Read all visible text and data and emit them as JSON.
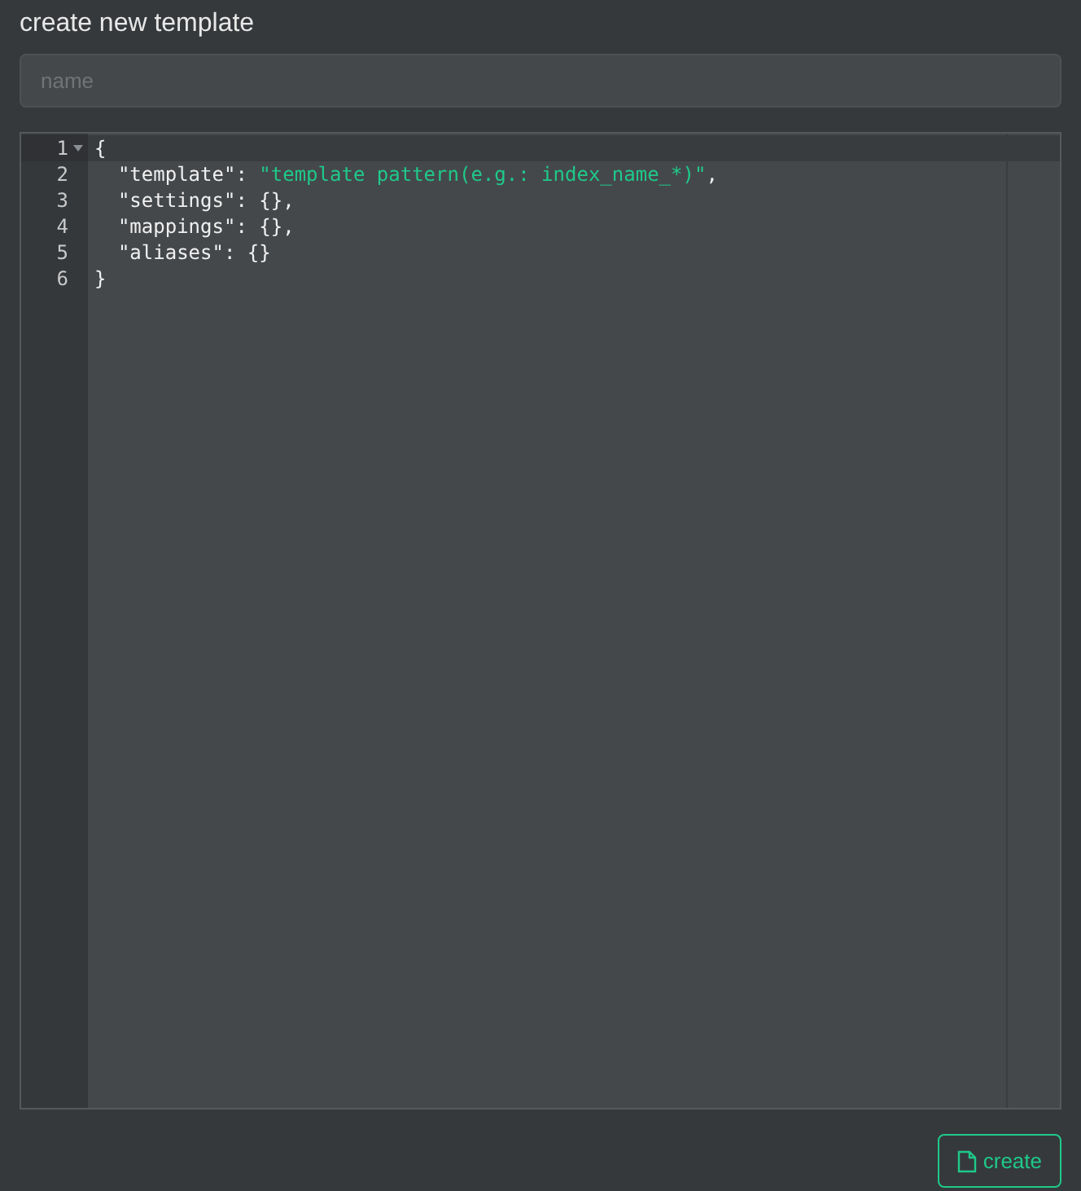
{
  "title": "create new template",
  "name_field": {
    "placeholder": "name"
  },
  "editor": {
    "lines": [
      {
        "number": "1",
        "active": true,
        "foldable": true,
        "segments": [
          {
            "kind": "plain",
            "text": "{"
          }
        ]
      },
      {
        "number": "2",
        "active": false,
        "foldable": false,
        "segments": [
          {
            "kind": "plain",
            "text": "  \"template\": "
          },
          {
            "kind": "string",
            "text": "\"template pattern(e.g.: index_name_*)\""
          },
          {
            "kind": "plain",
            "text": ","
          }
        ]
      },
      {
        "number": "3",
        "active": false,
        "foldable": false,
        "segments": [
          {
            "kind": "plain",
            "text": "  \"settings\": {},"
          }
        ]
      },
      {
        "number": "4",
        "active": false,
        "foldable": false,
        "segments": [
          {
            "kind": "plain",
            "text": "  \"mappings\": {},"
          }
        ]
      },
      {
        "number": "5",
        "active": false,
        "foldable": false,
        "segments": [
          {
            "kind": "plain",
            "text": "  \"aliases\": {}"
          }
        ]
      },
      {
        "number": "6",
        "active": false,
        "foldable": false,
        "segments": [
          {
            "kind": "plain",
            "text": "}"
          }
        ]
      }
    ]
  },
  "create_button": {
    "label": "create"
  }
}
